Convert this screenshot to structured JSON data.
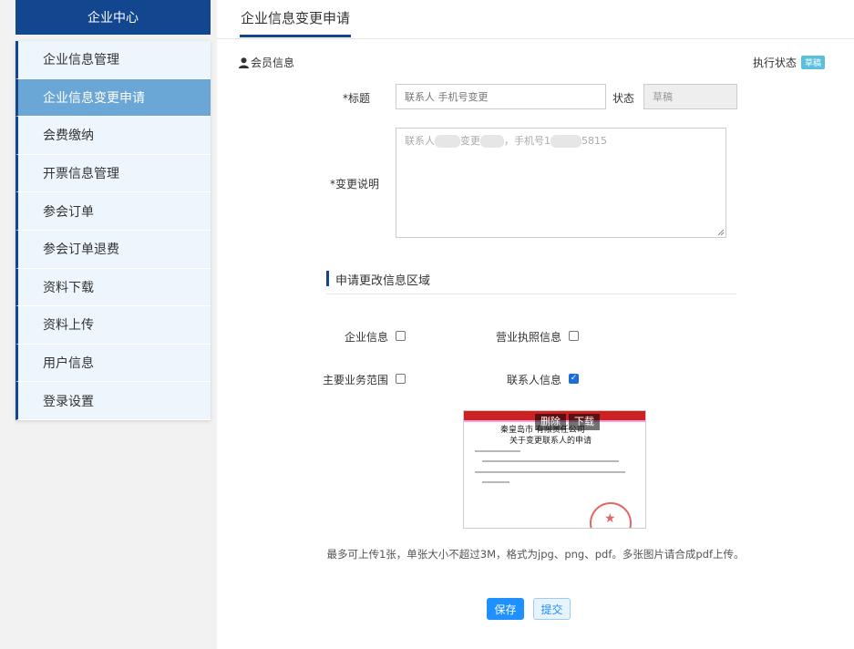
{
  "sidebar": {
    "title": "企业中心",
    "items": [
      {
        "label": "企业信息管理",
        "active": false
      },
      {
        "label": "企业信息变更申请",
        "active": true
      },
      {
        "label": "会费缴纳",
        "active": false
      },
      {
        "label": "开票信息管理",
        "active": false
      },
      {
        "label": "参会订单",
        "active": false
      },
      {
        "label": "参会订单退费",
        "active": false
      },
      {
        "label": "资料下载",
        "active": false
      },
      {
        "label": "资料上传",
        "active": false
      },
      {
        "label": "用户信息",
        "active": false
      },
      {
        "label": "登录设置",
        "active": false
      }
    ]
  },
  "main": {
    "tab": "企业信息变更申请",
    "member_label": "会员信息",
    "exec_status_label": "执行状态",
    "exec_status_badge": "草稿",
    "form": {
      "title_label": "*标题",
      "title_placeholder": "联系人 手机号变更",
      "status_label": "状态",
      "status_value": "草稿",
      "desc_label": "*变更说明",
      "desc_prefix": "联系人",
      "desc_mid": "变更",
      "desc_phone_label": "，手机号1",
      "desc_phone_tail": "5815"
    },
    "section_title": "申请更改信息区域",
    "checkboxes": [
      {
        "label": "企业信息",
        "checked": false
      },
      {
        "label": "营业执照信息",
        "checked": false
      },
      {
        "label": "主要业务范围",
        "checked": false
      },
      {
        "label": "联系人信息",
        "checked": true
      }
    ],
    "preview": {
      "delete_label": "删除",
      "download_label": "下载",
      "doc_title_line1": "秦皇岛市 有限责任公司",
      "doc_title_line2": "关于变更联系人的申请"
    },
    "hint": "最多可上传1张，单张大小不超过3M，格式为jpg、png、pdf。多张图片请合成pdf上传。",
    "buttons": {
      "save": "保存",
      "submit": "提交"
    }
  },
  "colors": {
    "brand": "#12468f",
    "active_menu": "#6aa6d6",
    "primary_button": "#1e90ff",
    "status_badge": "#5bc0de"
  }
}
